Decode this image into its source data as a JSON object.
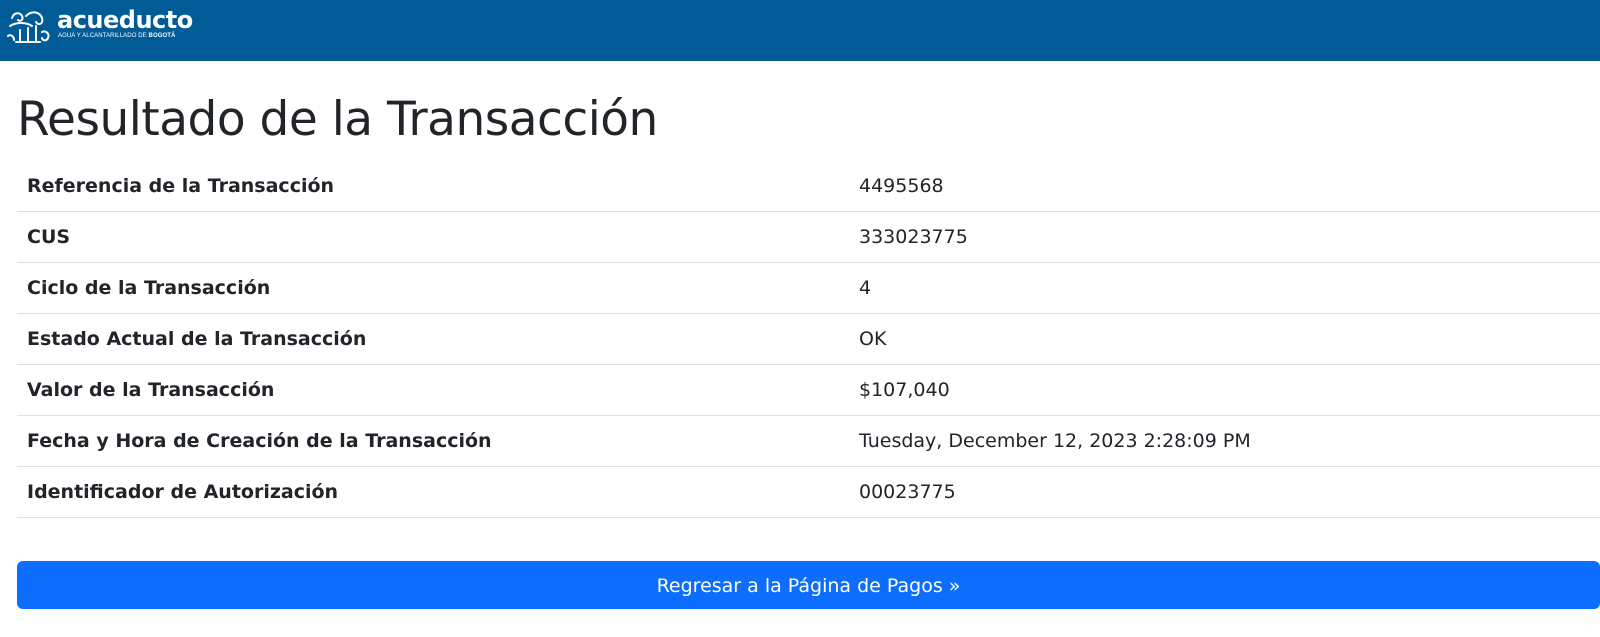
{
  "header": {
    "logo_word": "acueducto",
    "logo_tagline_prefix": "AGUA Y ALCANTARILLADO DE ",
    "logo_tagline_city": "BOGOTÁ",
    "background_color": "#005b97"
  },
  "page": {
    "title": "Resultado de la Transacción"
  },
  "transaction": {
    "rows": [
      {
        "label": "Referencia de la Transacción",
        "value": "4495568"
      },
      {
        "label": "CUS",
        "value": "333023775"
      },
      {
        "label": "Ciclo de la Transacción",
        "value": "4"
      },
      {
        "label": "Estado Actual de la Transacción",
        "value": "OK"
      },
      {
        "label": "Valor de la Transacción",
        "value": "$107,040"
      },
      {
        "label": "Fecha y Hora de Creación de la Transacción",
        "value": "Tuesday, December 12, 2023 2:28:09 PM"
      },
      {
        "label": "Identificador de Autorización",
        "value": "00023775"
      }
    ]
  },
  "actions": {
    "back_label": "Regresar a la Página de Pagos »",
    "back_color": "#0d6efd"
  }
}
